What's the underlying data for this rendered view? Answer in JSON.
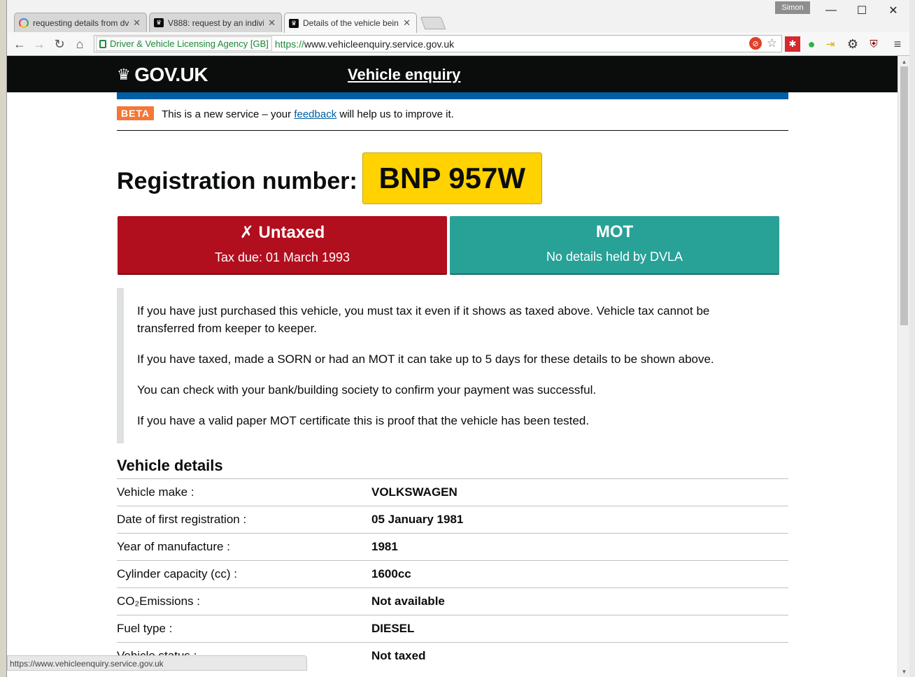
{
  "browser": {
    "tabs": [
      {
        "title": "requesting details from dv",
        "icon": "google-icon"
      },
      {
        "title": "V888: request by an indivi",
        "icon": "govuk-crown-icon"
      },
      {
        "title": "Details of the vehicle being",
        "icon": "govuk-crown-icon",
        "active": true
      }
    ],
    "profile_name": "Simon",
    "ev_label": "Driver & Vehicle Licensing Agency [GB]",
    "url_scheme": "https://",
    "url_rest": "www.vehicleenquiry.service.gov.uk",
    "status_url": "https://www.vehicleenquiry.service.gov.uk"
  },
  "header": {
    "logo_text": "GOV.UK",
    "service_name": "Vehicle enquiry"
  },
  "beta": {
    "tag": "BETA",
    "text_before": "This is a new service – your ",
    "link": "feedback",
    "text_after": " will help us to improve it."
  },
  "registration": {
    "label": "Registration number:",
    "plate": "BNP 957W"
  },
  "tax": {
    "heading": "✗ Untaxed",
    "sub": "Tax due: 01 March 1993",
    "color": "#b10e1e"
  },
  "mot": {
    "heading": "MOT",
    "sub": "No details held by DVLA",
    "color": "#28a197"
  },
  "info": [
    "If you have just purchased this vehicle, you must tax it even if it shows as taxed above. Vehicle tax cannot be transferred from keeper to keeper.",
    "If you have taxed, made a SORN or had an MOT it can take up to 5 days for these details to be shown above.",
    "You can check with your bank/building society to confirm your payment was successful.",
    "If you have a valid paper MOT certificate this is proof that the vehicle has been tested."
  ],
  "vehicle_details": {
    "heading": "Vehicle details",
    "rows": [
      {
        "label": "Vehicle make :",
        "value": "VOLKSWAGEN"
      },
      {
        "label": "Date of first registration :",
        "value": "05 January 1981"
      },
      {
        "label": "Year of manufacture :",
        "value": "1981"
      },
      {
        "label": "Cylinder capacity (cc) :",
        "value": "1600cc"
      },
      {
        "label": "CO₂Emissions :",
        "value": "Not available"
      },
      {
        "label": "Fuel type :",
        "value": "DIESEL"
      },
      {
        "label": "Vehicle status :",
        "value": "Not taxed"
      }
    ]
  }
}
